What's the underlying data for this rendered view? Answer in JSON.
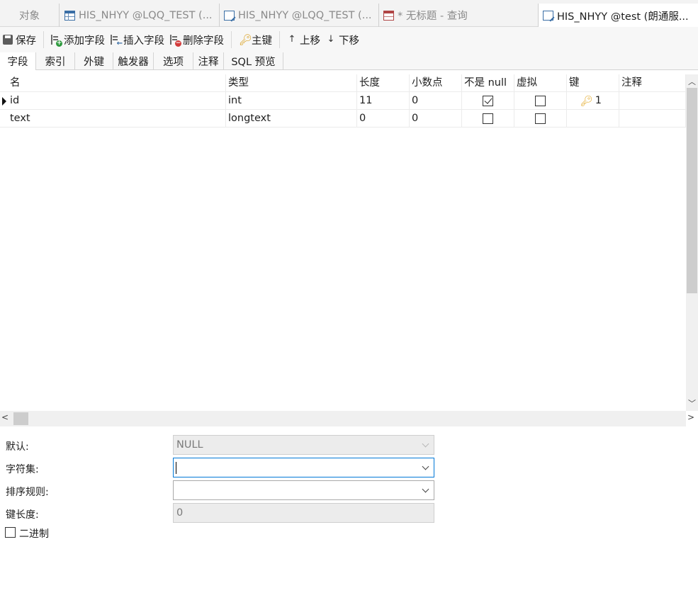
{
  "doc_tabs": [
    {
      "label": "对象",
      "icon": "none"
    },
    {
      "label": "HIS_NHYY @LQQ_TEST (...",
      "icon": "table-icon"
    },
    {
      "label": "HIS_NHYY @LQQ_TEST (...",
      "icon": "design-table-icon"
    },
    {
      "label": "* 无标题 - 查询",
      "icon": "query-icon"
    },
    {
      "label": "HIS_NHYY @test (朗通服...",
      "icon": "design-table-icon"
    }
  ],
  "toolbar": {
    "save": "保存",
    "add_field": "添加字段",
    "insert_field": "插入字段",
    "delete_field": "删除字段",
    "primary_key": "主键",
    "move_up": "上移",
    "move_down": "下移"
  },
  "sub_tabs": [
    "字段",
    "索引",
    "外键",
    "触发器",
    "选项",
    "注释",
    "SQL 预览"
  ],
  "grid": {
    "columns": [
      "名",
      "类型",
      "长度",
      "小数点",
      "不是 null",
      "虚拟",
      "键",
      "注释"
    ],
    "rows": [
      {
        "name": "id",
        "type": "int",
        "length": "11",
        "decimals": "0",
        "not_null": true,
        "virtual": false,
        "key": "1",
        "comment": "",
        "current": true
      },
      {
        "name": "text",
        "type": "longtext",
        "length": "0",
        "decimals": "0",
        "not_null": false,
        "virtual": false,
        "key": "",
        "comment": "",
        "current": false
      }
    ]
  },
  "properties": {
    "default_label": "默认:",
    "default_value": "NULL",
    "charset_label": "字符集:",
    "charset_value": "",
    "collation_label": "排序规则:",
    "collation_value": "",
    "key_length_label": "键长度:",
    "key_length_value": "0",
    "binary_label": "二进制",
    "binary_checked": false
  },
  "colors": {
    "accent": "#0078d7",
    "key_icon": "#e0a216"
  }
}
